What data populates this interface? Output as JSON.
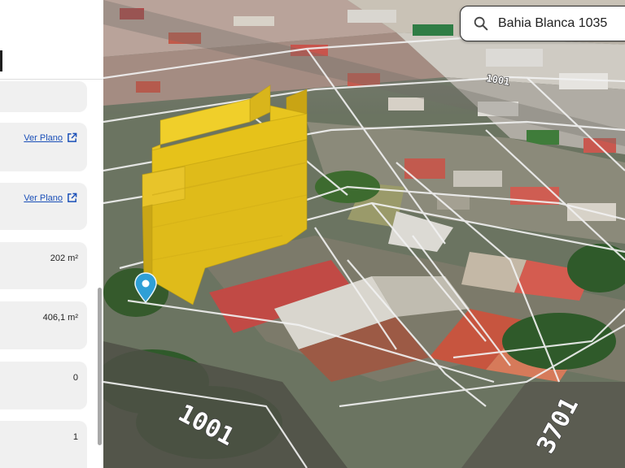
{
  "search": {
    "value": "Bahia Blanca 1035",
    "icon": "search-icon"
  },
  "panel": {
    "cards": [
      {
        "type": "link",
        "label": "Ver Plano",
        "icon": "external-link-icon"
      },
      {
        "type": "link",
        "label": "Ver Plano",
        "icon": "external-link-icon"
      },
      {
        "type": "value",
        "value": "202 m²"
      },
      {
        "type": "value",
        "value": "406,1 m²"
      },
      {
        "type": "value",
        "value": "0"
      },
      {
        "type": "value",
        "value": "1"
      }
    ]
  },
  "map": {
    "road_labels": [
      "1001",
      "1001",
      "3701"
    ],
    "marker_icon": "location-pin-icon",
    "building_color": "#e6c21a"
  }
}
